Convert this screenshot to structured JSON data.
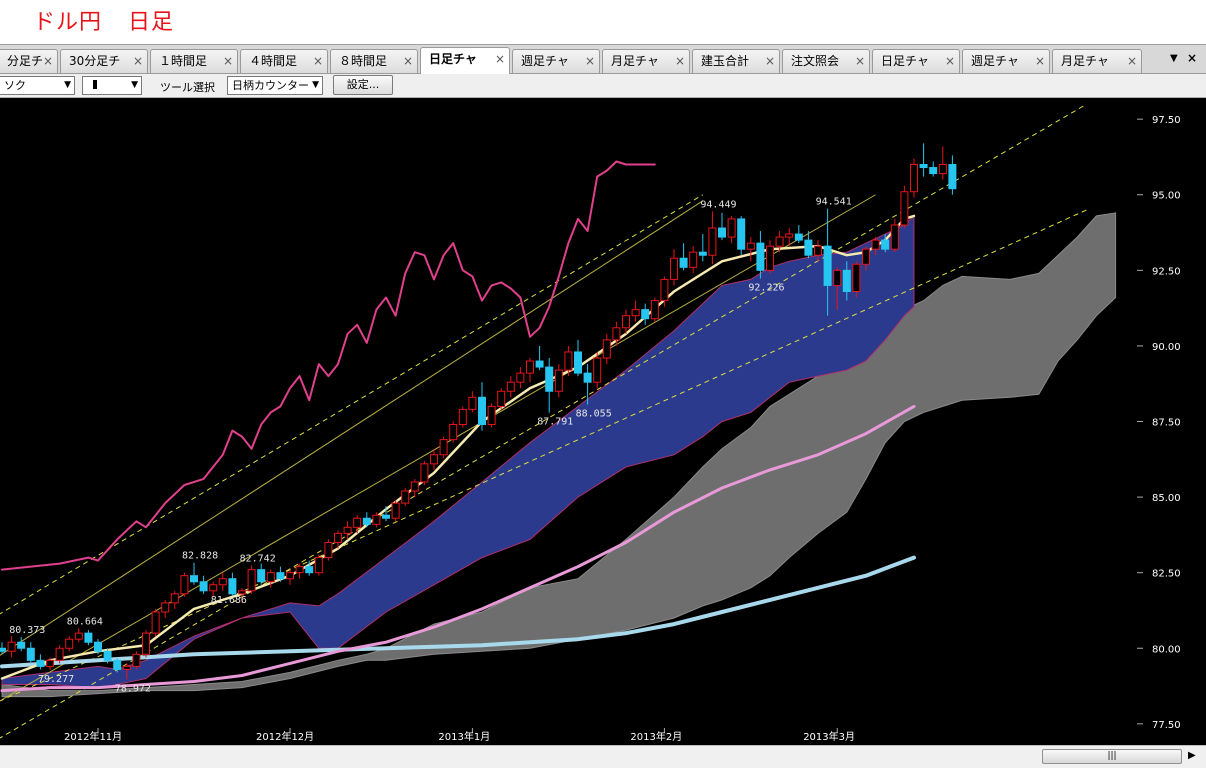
{
  "page_title": {
    "part1": "ドル円",
    "part2": "日足"
  },
  "tabs": [
    {
      "label": "分足チ",
      "active": false
    },
    {
      "label": "30分足チ",
      "active": false
    },
    {
      "label": "１時間足",
      "active": false
    },
    {
      "label": "４時間足",
      "active": false
    },
    {
      "label": "８時間足",
      "active": false
    },
    {
      "label": "日足チャ",
      "active": true
    },
    {
      "label": "週足チャ",
      "active": false
    },
    {
      "label": "月足チャ",
      "active": false
    },
    {
      "label": "建玉合計",
      "active": false
    },
    {
      "label": "注文照会",
      "active": false
    },
    {
      "label": "日足チャ",
      "active": false
    },
    {
      "label": "週足チャ",
      "active": false
    },
    {
      "label": "月足チャ",
      "active": false
    }
  ],
  "tab_close_glyph": "×",
  "tab_controls": {
    "menu": "▼",
    "close": "×"
  },
  "toolbar": {
    "chart_type": "ソク",
    "candle_style": "",
    "tool_label": "ツール選択",
    "tool_select": "日柄カウンター",
    "settings": "設定..."
  },
  "scrollbar": {
    "thumb": "|||",
    "arrow": "▶"
  },
  "colors": {
    "background": "#000000",
    "up_candle": "#e8141a",
    "down_candle": "#27c6f0",
    "cloud_blue": "#2b3a8c",
    "cloud_gray": "#6e6e6e",
    "momentum_line": "#e0408c",
    "ma_short": "#f5eab0",
    "ma_long_pink": "#e89ad8",
    "ma_long_blue": "#a8d8ec",
    "channel_solid": "#b8b040",
    "channel_dashed": "#dede40",
    "axis_text": "#ffffff"
  },
  "chart_data": {
    "type": "candlestick",
    "title": "",
    "xlabel": "",
    "ylabel": "",
    "ylim": [
      76.8,
      98.2
    ],
    "y_ticks": [
      "97.50",
      "95.00",
      "92.50",
      "90.00",
      "87.50",
      "85.00",
      "82.50",
      "80.00",
      "77.50"
    ],
    "x_ticks": [
      "2012年11月",
      "2012年12月",
      "2013年1月",
      "2013年2月",
      "2013年3月"
    ],
    "x_tick_index": [
      10,
      30,
      49,
      69,
      87
    ],
    "n_days": 100,
    "candles": [
      [
        80.0,
        80.2,
        79.8,
        79.9
      ],
      [
        79.9,
        80.4,
        79.7,
        80.2
      ],
      [
        80.2,
        80.37,
        79.9,
        80.0
      ],
      [
        80.0,
        80.2,
        79.5,
        79.6
      ],
      [
        79.6,
        79.8,
        79.3,
        79.4
      ],
      [
        79.4,
        79.7,
        79.28,
        79.6
      ],
      [
        79.6,
        80.1,
        79.5,
        80.0
      ],
      [
        80.0,
        80.4,
        79.9,
        80.3
      ],
      [
        80.3,
        80.66,
        80.2,
        80.5
      ],
      [
        80.5,
        80.6,
        80.1,
        80.2
      ],
      [
        80.2,
        80.3,
        79.8,
        79.9
      ],
      [
        79.9,
        80.0,
        79.5,
        79.6
      ],
      [
        79.6,
        79.7,
        79.2,
        79.3
      ],
      [
        79.3,
        79.5,
        78.97,
        79.4
      ],
      [
        79.4,
        79.9,
        79.3,
        79.8
      ],
      [
        79.8,
        80.6,
        79.7,
        80.5
      ],
      [
        80.5,
        81.3,
        80.4,
        81.2
      ],
      [
        81.2,
        81.6,
        81.0,
        81.5
      ],
      [
        81.5,
        81.9,
        81.3,
        81.8
      ],
      [
        81.8,
        82.5,
        81.7,
        82.4
      ],
      [
        82.4,
        82.83,
        82.1,
        82.2
      ],
      [
        82.2,
        82.4,
        81.8,
        81.9
      ],
      [
        81.9,
        82.2,
        81.7,
        82.1
      ],
      [
        82.1,
        82.5,
        81.9,
        82.3
      ],
      [
        82.3,
        82.5,
        81.7,
        81.8
      ],
      [
        81.8,
        82.0,
        81.5,
        81.9
      ],
      [
        81.9,
        82.74,
        81.8,
        82.6
      ],
      [
        82.6,
        82.8,
        82.1,
        82.2
      ],
      [
        82.2,
        82.6,
        82.0,
        82.5
      ],
      [
        82.5,
        82.7,
        82.2,
        82.3
      ],
      [
        82.3,
        82.6,
        82.1,
        82.5
      ],
      [
        82.5,
        82.8,
        82.3,
        82.7
      ],
      [
        82.7,
        82.9,
        82.4,
        82.5
      ],
      [
        82.5,
        83.1,
        82.4,
        83.0
      ],
      [
        83.0,
        83.6,
        82.9,
        83.5
      ],
      [
        83.5,
        83.9,
        83.3,
        83.8
      ],
      [
        83.8,
        84.2,
        83.6,
        84.0
      ],
      [
        84.0,
        84.4,
        83.8,
        84.3
      ],
      [
        84.3,
        84.5,
        84.0,
        84.1
      ],
      [
        84.1,
        84.5,
        84.0,
        84.4
      ],
      [
        84.4,
        84.7,
        84.2,
        84.3
      ],
      [
        84.3,
        84.9,
        84.2,
        84.8
      ],
      [
        84.8,
        85.3,
        84.7,
        85.2
      ],
      [
        85.2,
        85.6,
        85.0,
        85.5
      ],
      [
        85.5,
        86.2,
        85.4,
        86.1
      ],
      [
        86.1,
        86.6,
        85.9,
        86.4
      ],
      [
        86.4,
        87.0,
        86.3,
        86.9
      ],
      [
        86.9,
        87.5,
        86.8,
        87.4
      ],
      [
        87.4,
        88.0,
        87.3,
        87.9
      ],
      [
        87.9,
        88.5,
        87.8,
        88.3
      ],
      [
        88.3,
        88.8,
        87.2,
        87.4
      ],
      [
        87.4,
        88.1,
        87.3,
        88.0
      ],
      [
        88.0,
        88.6,
        87.9,
        88.5
      ],
      [
        88.5,
        89.0,
        88.3,
        88.8
      ],
      [
        88.8,
        89.3,
        88.6,
        89.1
      ],
      [
        89.1,
        89.6,
        88.8,
        89.5
      ],
      [
        89.5,
        90.0,
        89.2,
        89.3
      ],
      [
        89.3,
        89.6,
        87.79,
        88.5
      ],
      [
        88.5,
        89.4,
        88.3,
        89.2
      ],
      [
        89.2,
        90.0,
        89.0,
        89.8
      ],
      [
        89.8,
        90.2,
        89.0,
        89.1
      ],
      [
        89.1,
        89.4,
        88.06,
        88.8
      ],
      [
        88.8,
        89.8,
        88.6,
        89.6
      ],
      [
        89.6,
        90.4,
        89.4,
        90.2
      ],
      [
        90.2,
        90.8,
        90.0,
        90.6
      ],
      [
        90.6,
        91.2,
        90.4,
        91.0
      ],
      [
        91.0,
        91.5,
        90.8,
        91.2
      ],
      [
        91.2,
        91.4,
        90.7,
        90.9
      ],
      [
        90.9,
        91.6,
        90.8,
        91.5
      ],
      [
        91.5,
        92.3,
        91.3,
        92.2
      ],
      [
        92.2,
        93.2,
        92.0,
        92.9
      ],
      [
        92.9,
        93.4,
        92.5,
        92.6
      ],
      [
        92.6,
        93.3,
        92.4,
        93.1
      ],
      [
        93.1,
        93.7,
        92.8,
        93.0
      ],
      [
        93.0,
        94.45,
        92.7,
        93.9
      ],
      [
        93.9,
        94.4,
        93.5,
        93.6
      ],
      [
        93.6,
        94.3,
        93.4,
        94.2
      ],
      [
        94.2,
        94.3,
        93.0,
        93.2
      ],
      [
        93.2,
        93.6,
        92.8,
        93.4
      ],
      [
        93.4,
        93.8,
        92.23,
        92.5
      ],
      [
        92.5,
        93.5,
        92.4,
        93.3
      ],
      [
        93.3,
        93.8,
        93.1,
        93.6
      ],
      [
        93.6,
        93.9,
        93.3,
        93.7
      ],
      [
        93.7,
        94.0,
        93.4,
        93.5
      ],
      [
        93.5,
        93.8,
        92.9,
        93.0
      ],
      [
        93.0,
        93.5,
        92.8,
        93.3
      ],
      [
        93.3,
        94.54,
        91.0,
        92.0
      ],
      [
        92.0,
        92.6,
        91.2,
        92.5
      ],
      [
        92.5,
        92.8,
        91.5,
        91.8
      ],
      [
        91.8,
        92.8,
        91.6,
        92.7
      ],
      [
        92.7,
        93.3,
        92.5,
        93.2
      ],
      [
        93.2,
        93.6,
        93.0,
        93.5
      ],
      [
        93.5,
        93.7,
        93.1,
        93.2
      ],
      [
        93.2,
        94.2,
        93.1,
        94.0
      ],
      [
        94.0,
        95.3,
        93.9,
        95.1
      ],
      [
        95.1,
        96.2,
        94.9,
        96.0
      ],
      [
        96.0,
        96.7,
        95.6,
        95.9
      ],
      [
        95.9,
        96.1,
        95.6,
        95.7
      ],
      [
        95.7,
        96.6,
        95.5,
        96.0
      ],
      [
        96.0,
        96.3,
        95.0,
        95.2
      ]
    ],
    "price_labels": [
      {
        "text": "80.373",
        "i": 2,
        "pos": "above"
      },
      {
        "text": "80.664",
        "i": 8,
        "pos": "above"
      },
      {
        "text": "79.277",
        "i": 5,
        "pos": "below"
      },
      {
        "text": "78.972",
        "i": 13,
        "pos": "below"
      },
      {
        "text": "82.828",
        "i": 20,
        "pos": "above"
      },
      {
        "text": "82.742",
        "i": 26,
        "pos": "above"
      },
      {
        "text": "81.686",
        "i": 23,
        "pos": "below"
      },
      {
        "text": "87.791",
        "i": 57,
        "pos": "below"
      },
      {
        "text": "88.055",
        "i": 61,
        "pos": "below"
      },
      {
        "text": "94.449",
        "i": 74,
        "pos": "above"
      },
      {
        "text": "94.541",
        "i": 86,
        "pos": "above"
      },
      {
        "text": "92.226",
        "i": 79,
        "pos": "below"
      }
    ],
    "momentum_line": {
      "i": [
        0,
        3,
        6,
        9,
        10,
        12,
        14,
        15,
        17,
        19,
        21,
        23,
        24,
        25,
        26,
        27,
        28,
        29,
        30,
        31,
        32,
        33,
        34,
        35,
        36,
        37,
        38,
        39,
        40,
        41,
        42,
        43,
        44,
        45,
        46,
        47,
        48,
        49,
        50,
        51,
        52,
        53,
        54,
        55,
        56,
        57,
        58,
        59,
        60,
        61,
        62,
        63,
        64,
        65,
        66,
        67,
        68
      ],
      "v": [
        82.6,
        82.7,
        82.8,
        83.0,
        82.9,
        83.6,
        84.2,
        84.0,
        84.8,
        85.4,
        85.6,
        86.4,
        87.2,
        87.0,
        86.6,
        87.4,
        87.8,
        88.0,
        88.6,
        89.0,
        88.2,
        89.4,
        89.0,
        89.4,
        90.4,
        90.7,
        90.1,
        91.2,
        91.6,
        91.0,
        92.4,
        93.1,
        93.0,
        92.2,
        93.0,
        93.4,
        92.5,
        92.3,
        91.5,
        92.0,
        92.1,
        91.9,
        91.6,
        90.3,
        90.6,
        91.3,
        92.3,
        93.4,
        94.2,
        93.8,
        95.6,
        95.8,
        96.1,
        96.0,
        96.0,
        96.0,
        96.0
      ]
    },
    "ma_short": {
      "i": [
        0,
        5,
        10,
        15,
        20,
        25,
        30,
        35,
        40,
        45,
        50,
        55,
        60,
        65,
        70,
        75,
        80,
        85,
        88,
        90,
        92,
        94,
        95
      ],
      "v": [
        79.0,
        79.6,
        79.9,
        80.1,
        81.3,
        81.8,
        82.4,
        83.3,
        84.6,
        85.8,
        87.5,
        88.6,
        89.3,
        90.4,
        91.8,
        92.8,
        93.2,
        93.3,
        93.0,
        93.1,
        93.5,
        94.2,
        94.3
      ]
    },
    "ma_long_pink": {
      "i": [
        0,
        5,
        10,
        15,
        20,
        25,
        30,
        35,
        40,
        45,
        50,
        55,
        60,
        65,
        70,
        75,
        80,
        85,
        90,
        95
      ],
      "v": [
        78.6,
        78.7,
        78.7,
        78.8,
        78.9,
        79.1,
        79.5,
        79.9,
        80.2,
        80.7,
        81.3,
        82.0,
        82.7,
        83.5,
        84.5,
        85.3,
        85.9,
        86.4,
        87.1,
        88.0
      ]
    },
    "ma_long_blue": {
      "i": [
        0,
        10,
        20,
        30,
        40,
        50,
        60,
        65,
        70,
        75,
        80,
        85,
        90,
        95
      ],
      "v": [
        79.4,
        79.6,
        79.8,
        79.9,
        80.0,
        80.1,
        80.3,
        80.5,
        80.8,
        81.2,
        81.6,
        82.0,
        82.4,
        83.0
      ]
    },
    "cloud_blue": {
      "i": [
        0,
        5,
        10,
        12,
        15,
        20,
        25,
        30,
        33,
        35,
        40,
        45,
        50,
        55,
        60,
        65,
        70,
        73,
        75,
        78,
        80,
        82,
        85,
        88,
        90,
        92,
        94,
        95
      ],
      "upper": [
        79.0,
        79.2,
        79.4,
        79.3,
        79.6,
        80.4,
        81.0,
        81.5,
        81.4,
        81.8,
        83.0,
        84.2,
        85.5,
        86.8,
        88.0,
        89.2,
        90.5,
        91.4,
        92.0,
        92.2,
        92.6,
        92.8,
        93.0,
        93.1,
        93.4,
        93.7,
        94.0,
        94.3
      ],
      "lower": [
        78.8,
        78.8,
        78.7,
        78.8,
        79.0,
        80.3,
        81.0,
        81.2,
        80.0,
        80.0,
        81.2,
        82.1,
        83.0,
        83.6,
        85.0,
        86.0,
        86.4,
        87.0,
        87.5,
        87.8,
        88.3,
        88.8,
        89.0,
        89.2,
        89.5,
        90.2,
        91.0,
        91.3
      ]
    },
    "cloud_gray": {
      "i": [
        0,
        5,
        10,
        15,
        20,
        25,
        30,
        35,
        38,
        40,
        45,
        50,
        55,
        60,
        65,
        70,
        73,
        75,
        78,
        80,
        82,
        85,
        88,
        90,
        92,
        94,
        96,
        98,
        100,
        105,
        108,
        110,
        112,
        114,
        116
      ],
      "upper": [
        78.8,
        78.6,
        78.6,
        78.7,
        78.8,
        78.9,
        79.2,
        79.6,
        79.8,
        80.0,
        80.8,
        81.2,
        82.0,
        82.3,
        83.6,
        85.0,
        86.0,
        86.6,
        87.3,
        88.0,
        88.4,
        89.0,
        89.6,
        90.5,
        91.0,
        91.2,
        91.5,
        92.0,
        92.3,
        92.2,
        92.4,
        93.0,
        93.6,
        94.3,
        94.4
      ],
      "lower": [
        78.4,
        78.4,
        78.5,
        78.6,
        78.6,
        78.7,
        79.0,
        79.4,
        79.6,
        79.6,
        79.8,
        79.9,
        80.0,
        80.3,
        80.6,
        81.0,
        81.4,
        81.6,
        82.0,
        82.4,
        83.0,
        83.8,
        84.5,
        85.6,
        86.8,
        87.5,
        87.8,
        88.0,
        88.2,
        88.3,
        88.4,
        89.5,
        90.2,
        91.0,
        91.6
      ]
    },
    "channels": {
      "solid": [
        [
          -2,
          79.4,
          73,
          94.8
        ],
        [
          0,
          78.3,
          91,
          95.0
        ]
      ],
      "dashed": [
        [
          -2,
          76.7,
          113,
          98.0
        ],
        [
          -2,
          80.8,
          73,
          95.0
        ],
        [
          -2,
          78.0,
          113,
          94.5
        ]
      ]
    }
  }
}
